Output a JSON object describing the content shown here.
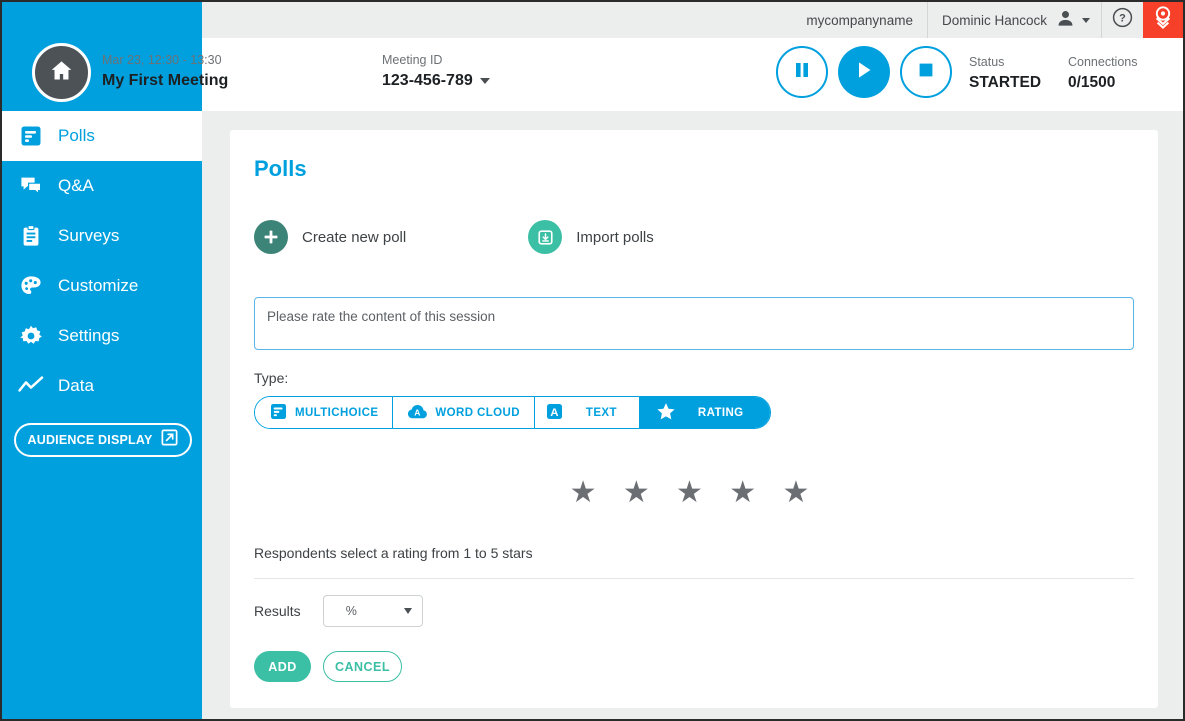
{
  "topbar": {
    "company": "mycompanyname",
    "user": "Dominic Hancock",
    "help_icon": "question-circle-icon",
    "logo_icon": "location-pin-icon",
    "logo_color": "#f6402a"
  },
  "meeting": {
    "home_icon": "home-icon",
    "date_range": "Mar 23, 12:30 - 13:30",
    "title": "My First Meeting",
    "meeting_id_label": "Meeting ID",
    "meeting_id_value": "123-456-789",
    "controls": [
      {
        "name": "pause-button",
        "icon": "pause-icon",
        "style": "outline"
      },
      {
        "name": "play-button",
        "icon": "play-icon",
        "style": "filled"
      },
      {
        "name": "stop-button",
        "icon": "stop-icon",
        "style": "outline"
      }
    ],
    "status_label": "Status",
    "status_value": "STARTED",
    "connections_label": "Connections",
    "connections_value": "0/1500"
  },
  "sidebar": {
    "accent": "#00a0df",
    "items": [
      {
        "label": "Polls",
        "icon": "poll-bars-icon",
        "active": true
      },
      {
        "label": "Q&A",
        "icon": "chat-bubbles-icon",
        "active": false
      },
      {
        "label": "Surveys",
        "icon": "clipboard-icon",
        "active": false
      },
      {
        "label": "Customize",
        "icon": "palette-icon",
        "active": false
      },
      {
        "label": "Settings",
        "icon": "gear-icon",
        "active": false
      },
      {
        "label": "Data",
        "icon": "line-chart-icon",
        "active": false
      }
    ],
    "audience_display": {
      "label": "AUDIENCE DISPLAY",
      "icon": "external-link-icon"
    }
  },
  "main": {
    "title": "Polls",
    "actions": [
      {
        "label": "Create new poll",
        "icon": "plus-icon",
        "color": "#3d8478"
      },
      {
        "label": "Import polls",
        "icon": "import-tray-icon",
        "color": "#3bbfa5"
      }
    ],
    "question": {
      "value": "Please rate the content of this session",
      "placeholder": "Please rate the content of this session"
    },
    "type_label": "Type:",
    "types": [
      {
        "label": "MULTICHOICE",
        "icon": "poll-bars-icon",
        "active": false
      },
      {
        "label": "WORD CLOUD",
        "icon": "cloud-a-icon",
        "active": false
      },
      {
        "label": "TEXT",
        "icon": "letter-a-icon",
        "active": false
      },
      {
        "label": "RATING",
        "icon": "star-icon",
        "active": true
      }
    ],
    "preview_stars": "★ ★ ★ ★ ★",
    "description": "Respondents select a rating from 1 to 5 stars",
    "results_label": "Results",
    "results_value": "%",
    "results_options": [
      "%",
      "#"
    ],
    "add_label": "ADD",
    "cancel_label": "CANCEL",
    "accent_teal": "#3bbfa5"
  }
}
